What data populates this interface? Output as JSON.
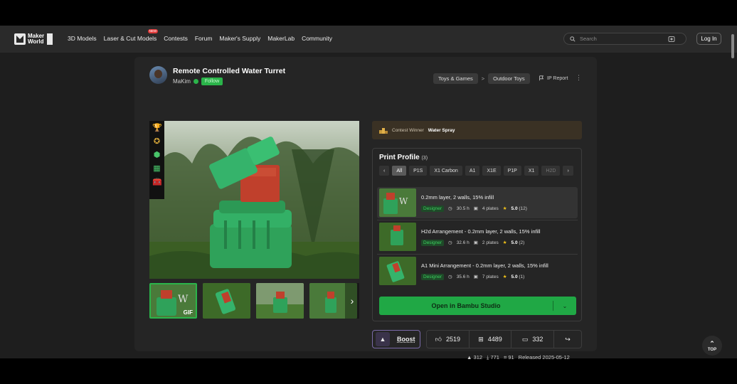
{
  "nav": {
    "logo_line1": "Maker",
    "logo_line2": "World",
    "links": [
      "3D Models",
      "Laser & Cut Models",
      "Contests",
      "Forum",
      "Maker's Supply",
      "MakerLab",
      "Community"
    ],
    "new_badge": "NEW",
    "search_placeholder": "Search",
    "login_label": "Log In"
  },
  "model": {
    "title": "Remote Controlled Water Turret",
    "author": "MaKim",
    "follow_label": "Follow",
    "breadcrumbs": [
      "Toys & Games",
      "Outdoor Toys"
    ],
    "breadcrumb_sep": ">",
    "ip_report": "IP Report",
    "gif_tag": "GIF"
  },
  "contest": {
    "prefix": "Contest Winner",
    "name": "Water Spray"
  },
  "print_profile": {
    "title": "Print Profile",
    "count": "(3)",
    "filters": [
      "All",
      "P1S",
      "X1 Carbon",
      "A1",
      "X1E",
      "P1P",
      "X1",
      "H2D"
    ],
    "items": [
      {
        "name": "0.2mm layer, 2 walls, 15% infill",
        "badge": "Designer",
        "time": "30.5 h",
        "plates": "4 plates",
        "rating": "5.0",
        "reviews": "(12)"
      },
      {
        "name": "H2d Arrangement - 0.2mm layer, 2 walls, 15% infill",
        "badge": "Designer",
        "time": "32.6 h",
        "plates": "2 plates",
        "rating": "5.0",
        "reviews": "(2)"
      },
      {
        "name": "A1 Mini Arrangement - 0.2mm layer, 2 walls, 15% infill",
        "badge": "Designer",
        "time": "35.6 h",
        "plates": "7 plates",
        "rating": "5.0",
        "reviews": "(1)"
      }
    ],
    "open_label": "Open in Bambu Studio"
  },
  "actions": {
    "boost_label": "Boost",
    "likes": "2519",
    "collects": "4489",
    "comments": "332"
  },
  "meta": {
    "boosts": "312",
    "downloads": "771",
    "prints": "91",
    "released": "Released 2025-05-12"
  },
  "top_label": "TOP",
  "colors": {
    "accent": "#20a845",
    "background": "#1e1e1e",
    "card": "#252525"
  }
}
